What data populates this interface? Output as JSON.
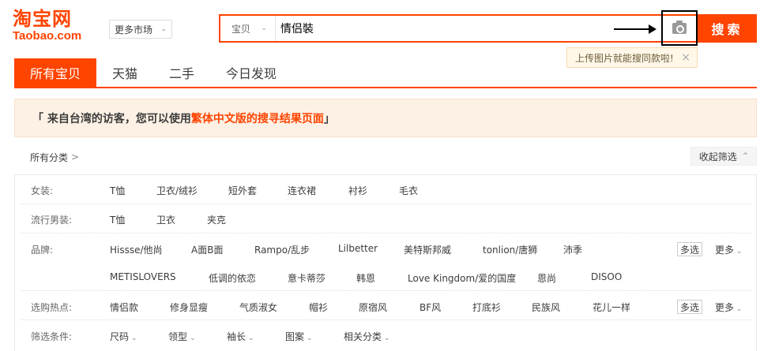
{
  "logo": {
    "cn": "淘宝网",
    "en": "Taobao.com"
  },
  "market": {
    "label": "更多市场",
    "chevron": "chevron-down-icon"
  },
  "search": {
    "type_label": "宝贝",
    "query": "情侣裝",
    "button_label": "搜索",
    "camera_icon": "camera-icon"
  },
  "tooltip": {
    "text": "上传图片就能搜同款啦!",
    "close": "×"
  },
  "tabs": [
    {
      "label": "所有宝贝",
      "active": true
    },
    {
      "label": "天猫",
      "active": false
    },
    {
      "label": "二手",
      "active": false
    },
    {
      "label": "今日发现",
      "active": false
    }
  ],
  "notice": {
    "open": "「 来自台湾的访客，您可以使用",
    "link": "繁体中文版的搜寻结果页面",
    "close": " 」"
  },
  "breadcrumb": {
    "label": "所有分类",
    "chevron": ">"
  },
  "collapse": {
    "label": "收起筛选",
    "chevron": "^"
  },
  "filters": {
    "women": {
      "label": "女装:",
      "items": [
        "T恤",
        "卫衣/绒衫",
        "短外套",
        "连衣裙",
        "衬衫",
        "毛衣"
      ]
    },
    "men": {
      "label": "流行男装:",
      "items": [
        "T恤",
        "卫衣",
        "夹克"
      ]
    },
    "brand": {
      "label": "品牌:",
      "row1": [
        "Hissse/他尚",
        "A面B面",
        "Rampo/乱步",
        "Lilbetter",
        "美特斯邦威",
        "tonlion/唐狮",
        "沛季"
      ],
      "row2": [
        "METISLOVERS",
        "低调的依恋",
        "意卡蒂莎",
        "韩恩",
        "Love Kingdom/爱的国度",
        "恩尚",
        "DISOO"
      ],
      "multi": "多选",
      "more": "更多"
    },
    "hot": {
      "label": "选购热点:",
      "items": [
        "情侣款",
        "修身显瘦",
        "气质淑女",
        "帽衫",
        "原宿风",
        "BF风",
        "打底衫",
        "民族风",
        "花儿一样"
      ],
      "multi": "多选",
      "more": "更多"
    },
    "conditions": {
      "label": "筛选条件:",
      "items": [
        "尺码",
        "领型",
        "袖长",
        "图案",
        "相关分类"
      ]
    }
  }
}
